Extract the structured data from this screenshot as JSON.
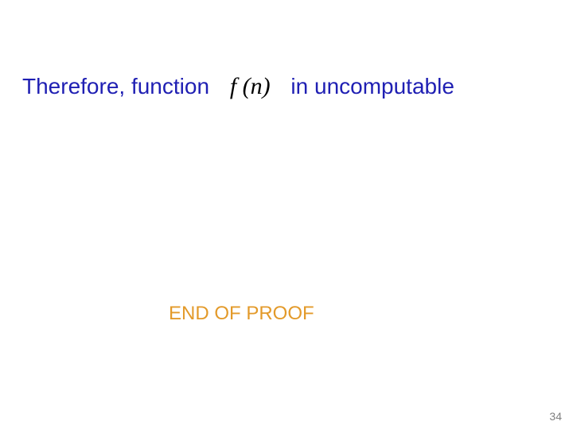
{
  "line": {
    "prefix": "Therefore, function",
    "math": "f (n)",
    "suffix": "in uncomputable"
  },
  "end_of_proof": "END OF PROOF",
  "page_number": "34"
}
